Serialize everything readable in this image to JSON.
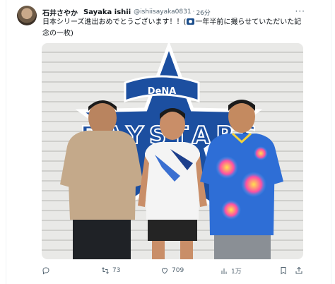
{
  "tweet": {
    "display_name_jp": "石井さやか",
    "display_name_en": "Sayaka ishii",
    "handle": "@ishiisayaka0831",
    "separator": "·",
    "time": "26分",
    "text_main": "日本シリーズ進出おめでとうございます！！(",
    "text_rest": "一年半前に撮らせていただいた記念の一枚)",
    "camera_icon": "camera-icon"
  },
  "photo": {
    "dena_text": "DeNA",
    "baystars_text": "BAYSTARS"
  },
  "actions": {
    "reply_count": "",
    "retweet_count": "73",
    "like_count": "709",
    "views_count": "1万"
  },
  "colors": {
    "star_blue": "#1c4fa0",
    "retweet_green": "#00ba7c"
  }
}
